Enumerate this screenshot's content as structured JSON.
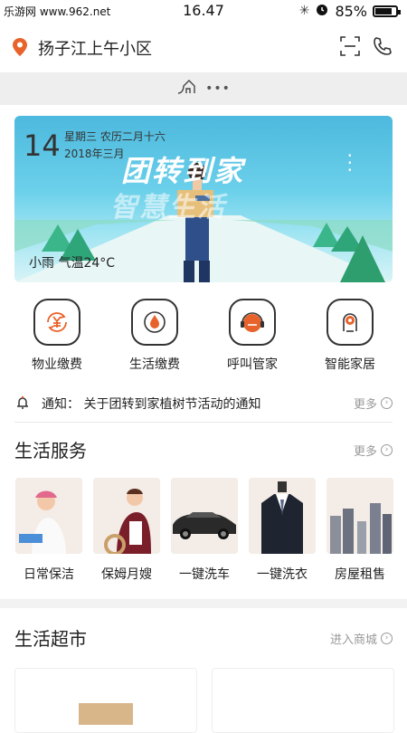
{
  "status": {
    "watermark": "乐游网 www.962.net",
    "time": "16.47",
    "battery": "85%",
    "battery_level": 0.85
  },
  "header": {
    "location": "扬子江上午小区"
  },
  "banner": {
    "day": "14",
    "weekday_lunar": "星期三  农历二月十六",
    "year_month": "2018年三月",
    "slogan": "团转到家",
    "slogan_sub": "智慧生活",
    "weather": "小雨 气温24°C"
  },
  "quick_actions": [
    {
      "label": "物业缴费",
      "icon": "yuan-refresh-icon"
    },
    {
      "label": "生活缴费",
      "icon": "droplet-icon"
    },
    {
      "label": "呼叫管家",
      "icon": "headset-icon"
    },
    {
      "label": "智能家居",
      "icon": "smart-home-icon"
    }
  ],
  "notice": {
    "text": "通知：  关于团转到家植树节活动的通知",
    "more": "更多"
  },
  "life_services": {
    "title": "生活服务",
    "more": "更多",
    "items": [
      {
        "label": "日常保洁"
      },
      {
        "label": "保姆月嫂"
      },
      {
        "label": "一键洗车"
      },
      {
        "label": "一键洗衣"
      },
      {
        "label": "房屋租售"
      }
    ]
  },
  "market": {
    "title": "生活超市",
    "enter": "进入商城"
  },
  "colors": {
    "accent": "#e8632b",
    "banner_sky": "#4db9de"
  }
}
